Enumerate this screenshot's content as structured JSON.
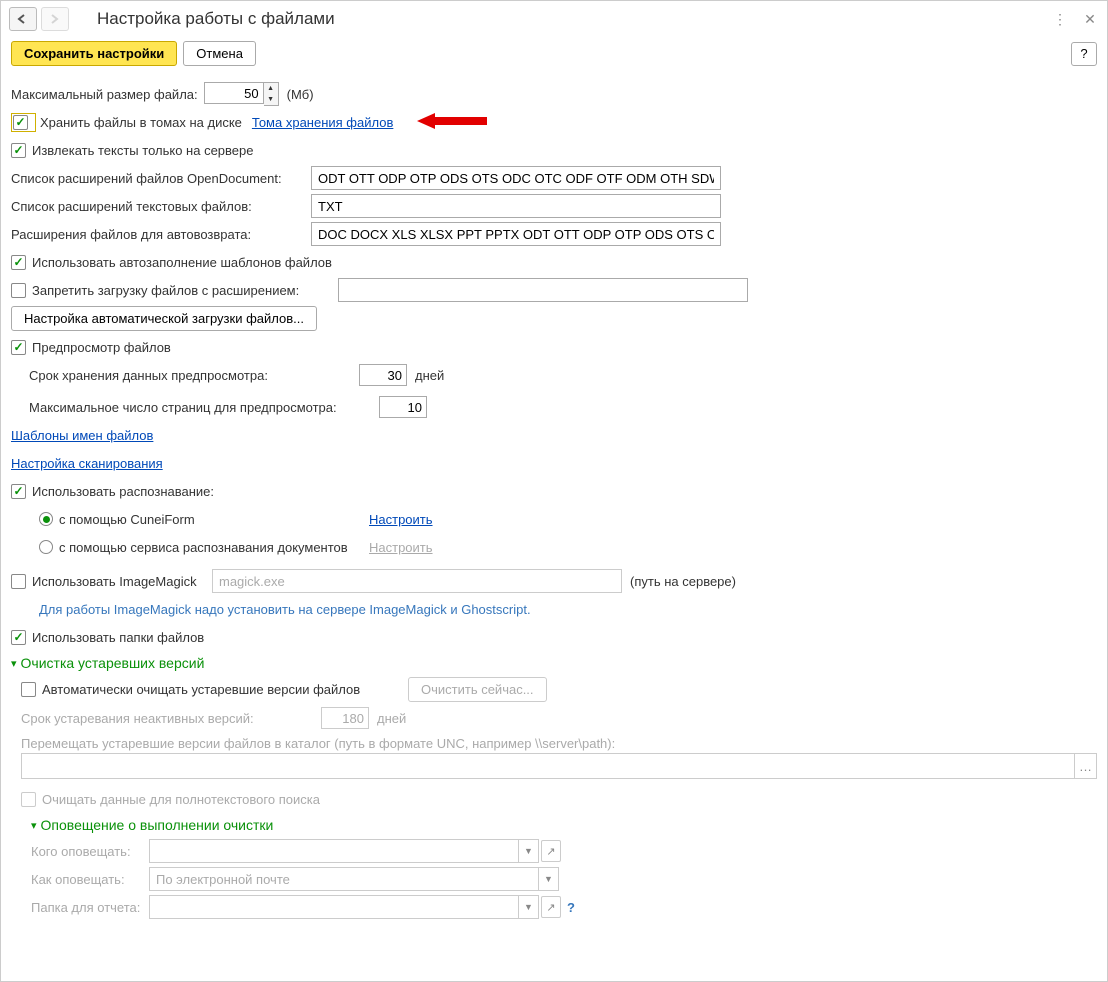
{
  "title": "Настройка работы с файлами",
  "toolbar": {
    "save": "Сохранить настройки",
    "cancel": "Отмена",
    "help": "?"
  },
  "maxFileSize": {
    "label": "Максимальный размер файла:",
    "value": "50",
    "unit": "(Мб)"
  },
  "storeInVolumes": {
    "label": "Хранить файлы в томах на диске",
    "link": "Тома хранения файлов"
  },
  "extractOnServer": "Извлекать тексты только на сервере",
  "odExt": {
    "label": "Список расширений файлов OpenDocument:",
    "value": "ODT OTT ODP OTP ODS OTS ODC OTC ODF OTF ODM OTH SDW"
  },
  "txtExt": {
    "label": "Список расширений текстовых файлов:",
    "value": "TXT"
  },
  "autoReturnExt": {
    "label": "Расширения файлов для автовозврата:",
    "value": "DOC DOCX XLS XLSX PPT PPTX ODT OTT ODP OTP ODS OTS ODC"
  },
  "autoFillTemplates": "Использовать автозаполнение шаблонов файлов",
  "forbidExt": {
    "label": "Запретить загрузку файлов с расширением:"
  },
  "autoLoadBtn": "Настройка автоматической загрузки файлов...",
  "preview": {
    "label": "Предпросмотр файлов",
    "retention": {
      "label": "Срок хранения данных предпросмотра:",
      "value": "30",
      "unit": "дней"
    },
    "maxPages": {
      "label": "Максимальное число страниц для предпросмотра:",
      "value": "10"
    }
  },
  "nameTemplatesLink": "Шаблоны имен файлов",
  "scanSettingsLink": "Настройка сканирования",
  "ocr": {
    "label": "Использовать распознавание:",
    "cuneiform": "с помощью CuneiForm",
    "docService": "с помощью сервиса распознавания документов",
    "configure": "Настроить",
    "configureDisabled": "Настроить"
  },
  "imagemagick": {
    "label": "Использовать ImageMagick",
    "value": "magick.exe",
    "pathHint": "(путь на сервере)",
    "info": "Для работы ImageMagick надо установить на сервере ImageMagick и Ghostscript."
  },
  "useFolders": "Использовать папки файлов",
  "cleanup": {
    "header": "Очистка устаревших версий",
    "auto": "Автоматически очищать устаревшие версии файлов",
    "nowBtn": "Очистить сейчас...",
    "agingLabel": "Срок устаревания неактивных версий:",
    "agingValue": "180",
    "agingUnit": "дней",
    "moveLabel": "Перемещать устаревшие версии файлов в каталог (путь в формате UNC, например \\\\server\\path):",
    "clearFulltext": "Очищать данные для полнотекстового поиска"
  },
  "notify": {
    "header": "Оповещение о выполнении очистки",
    "whoLabel": "Кого оповещать:",
    "howLabel": "Как оповещать:",
    "howValue": "По электронной почте",
    "folderLabel": "Папка для отчета:"
  }
}
